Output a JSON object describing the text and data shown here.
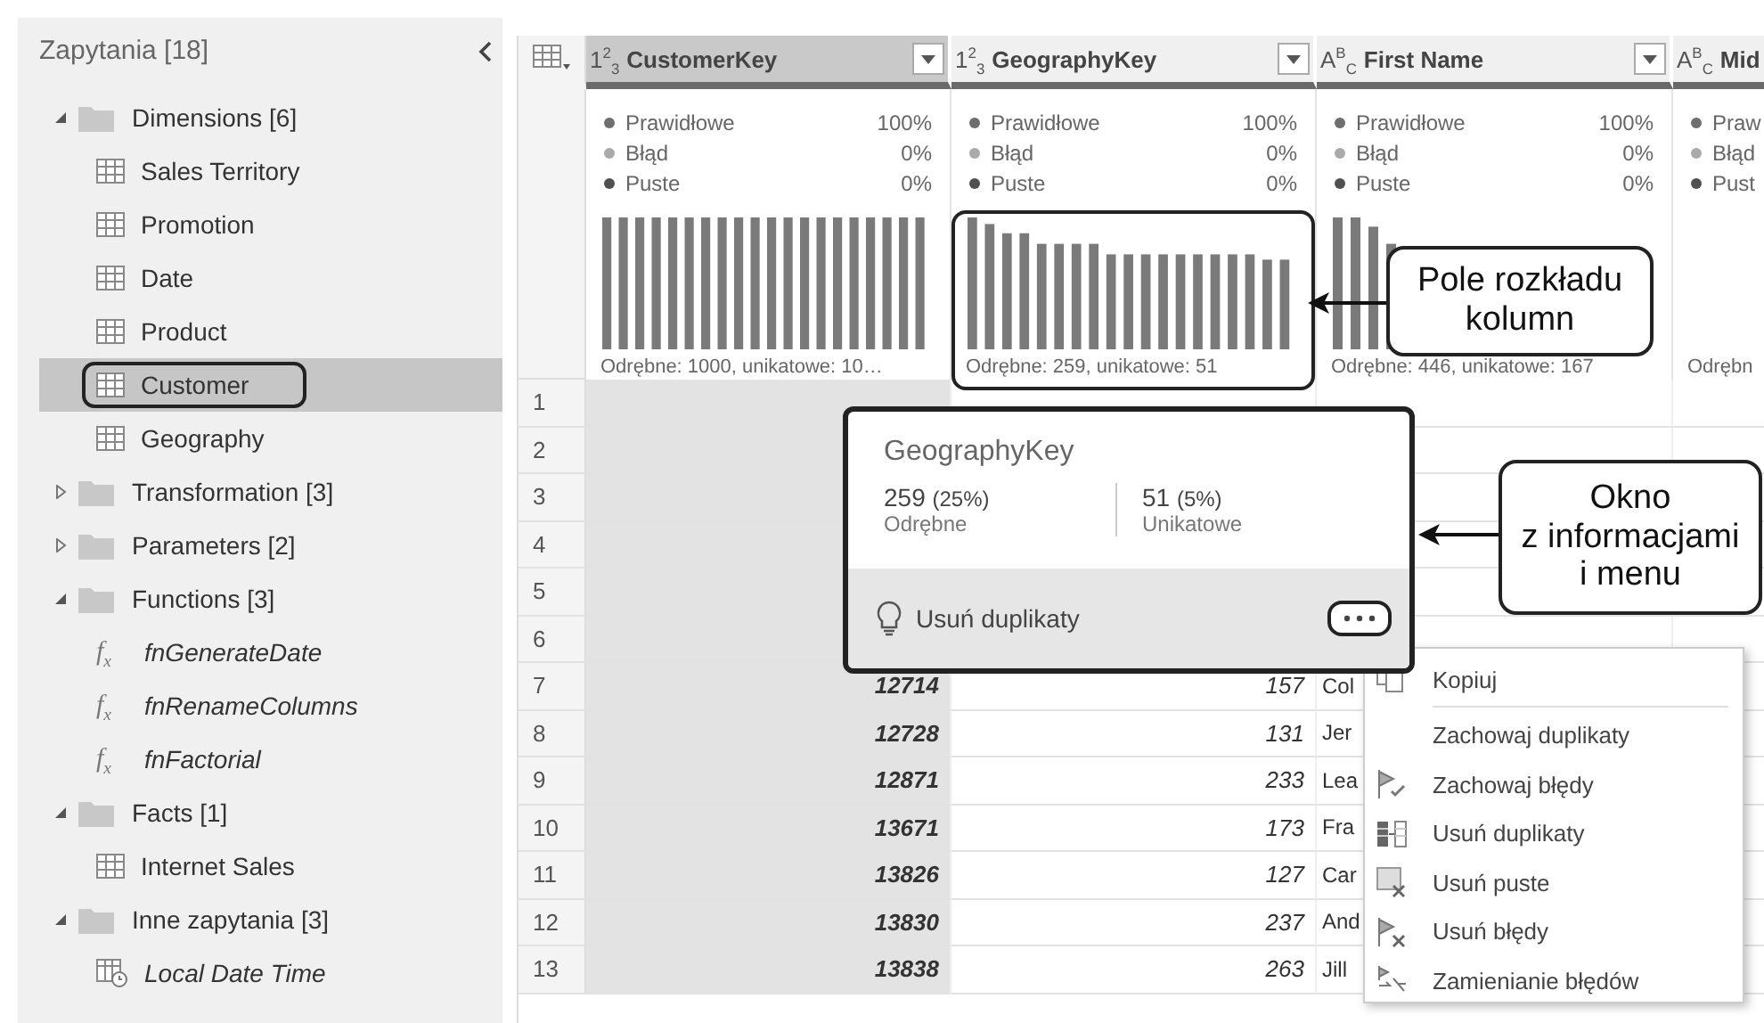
{
  "sidebar": {
    "title": "Zapytania [18]",
    "tree": [
      {
        "label": "Dimensions [6]",
        "kind": "folder",
        "expanded": true,
        "children": [
          {
            "label": "Sales Territory",
            "kind": "table",
            "selected": false
          },
          {
            "label": "Promotion",
            "kind": "table",
            "selected": false
          },
          {
            "label": "Date",
            "kind": "table",
            "selected": false
          },
          {
            "label": "Product",
            "kind": "table",
            "selected": false
          },
          {
            "label": "Customer",
            "kind": "table",
            "selected": true
          },
          {
            "label": "Geography",
            "kind": "table",
            "selected": false
          }
        ]
      },
      {
        "label": "Transformation [3]",
        "kind": "folder",
        "expanded": false
      },
      {
        "label": "Parameters [2]",
        "kind": "folder",
        "expanded": false
      },
      {
        "label": "Functions [3]",
        "kind": "folder",
        "expanded": true,
        "children": [
          {
            "label": "fnGenerateDate",
            "kind": "function",
            "glyph": "f$_{x}$",
            "selected": false
          },
          {
            "label": "fnRenameColumns",
            "kind": "function",
            "glyph": "f$_{x}$",
            "selected": false
          },
          {
            "label": "fnFactorial",
            "kind": "function",
            "glyph": "f$_{x}$",
            "selected": false
          }
        ]
      },
      {
        "label": "Facts [1]",
        "kind": "folder",
        "expanded": true,
        "children": [
          {
            "label": "Internet Sales",
            "kind": "table",
            "selected": false
          }
        ]
      },
      {
        "label": "Inne zapytania [3]",
        "kind": "folder",
        "expanded": true,
        "children": [
          {
            "label": "Local Date Time",
            "kind": "datetime",
            "selected": false
          }
        ]
      }
    ]
  },
  "grid": {
    "columns": [
      {
        "name": "CustomerKey",
        "type_glyph": "1$^{2}$$_{3}$",
        "selected": true,
        "filter": true,
        "outlined": false,
        "summary": "Odrębne: 1000, unikatowe: 10…",
        "stats": [
          {
            "label": "Prawidłowe",
            "value": "100%",
            "color": "#6e6e6e"
          },
          {
            "label": "Błąd",
            "value": "0%",
            "color": "#aaaaaa"
          },
          {
            "label": "Puste",
            "value": "0%",
            "color": "#505050"
          }
        ]
      },
      {
        "name": "GeographyKey",
        "type_glyph": "1$^{2}$$_{3}$",
        "selected": false,
        "filter": true,
        "outlined": true,
        "summary": "Odrębne: 259, unikatowe: 51",
        "stats": [
          {
            "label": "Prawidłowe",
            "value": "100%",
            "color": "#6e6e6e"
          },
          {
            "label": "Błąd",
            "value": "0%",
            "color": "#aaaaaa"
          },
          {
            "label": "Puste",
            "value": "0%",
            "color": "#505050"
          }
        ]
      },
      {
        "name": "First Name",
        "type_glyph": "A$^{B}$$_{C}$",
        "selected": false,
        "filter": true,
        "outlined": false,
        "summary": "Odrębne: 446, unikatowe: 167",
        "stats": [
          {
            "label": "Prawidłowe",
            "value": "100%",
            "color": "#6e6e6e"
          },
          {
            "label": "Błąd",
            "value": "0%",
            "color": "#aaaaaa"
          },
          {
            "label": "Puste",
            "value": "0%",
            "color": "#505050"
          }
        ]
      },
      {
        "name": "Mid",
        "type_glyph": "A$^{B}$$_{C}$",
        "selected": false,
        "outlined": false,
        "summary": "Odrębn",
        "stats": [
          {
            "label": "Praw",
            "color": "#6e6e6e"
          },
          {
            "label": "Błąd",
            "color": "#aaaaaa"
          },
          {
            "label": "Pust",
            "color": "#505050"
          }
        ]
      }
    ],
    "rows": [
      {
        "number": "1"
      },
      {
        "number": "2"
      },
      {
        "number": "3"
      },
      {
        "number": "4"
      },
      {
        "number": "5"
      },
      {
        "number": "6"
      },
      {
        "number": "7",
        "customer_key": "12714",
        "geography_key": "157",
        "first_name": "Col"
      },
      {
        "number": "8",
        "customer_key": "12728",
        "geography_key": "131",
        "first_name": "Jer"
      },
      {
        "number": "9",
        "customer_key": "12871",
        "geography_key": "233",
        "first_name": "Lea"
      },
      {
        "number": "10",
        "customer_key": "13671",
        "geography_key": "173",
        "first_name": "Fra"
      },
      {
        "number": "11",
        "customer_key": "13826",
        "geography_key": "127",
        "first_name": "Car"
      },
      {
        "number": "12",
        "customer_key": "13830",
        "geography_key": "237",
        "first_name": "And"
      },
      {
        "number": "13",
        "customer_key": "13838",
        "geography_key": "263",
        "first_name": "Jill"
      }
    ]
  },
  "popup": {
    "title": "GeographyKey",
    "stats": [
      {
        "count": "259",
        "share": "(25%)",
        "label": "Odrębne"
      },
      {
        "count": "51",
        "share": "(5%)",
        "label": "Unikatowe"
      }
    ],
    "suggestion": "Usuń duplikaty"
  },
  "menu": {
    "groups": [
      [
        {
          "label": "Kopiuj"
        }
      ],
      [
        {
          "label": "Zachowaj duplikaty"
        },
        {
          "label": "Zachowaj błędy"
        },
        {
          "label": "Usuń duplikaty"
        },
        {
          "label": "Usuń puste"
        },
        {
          "label": "Usuń błędy"
        },
        {
          "label": "Zamienianie błędów"
        }
      ]
    ]
  },
  "callouts": [
    {
      "lines": [
        "Pole rozkładu",
        "kolumn"
      ]
    },
    {
      "lines": [
        "Okno",
        "z informacjami",
        "i menu"
      ]
    }
  ]
}
